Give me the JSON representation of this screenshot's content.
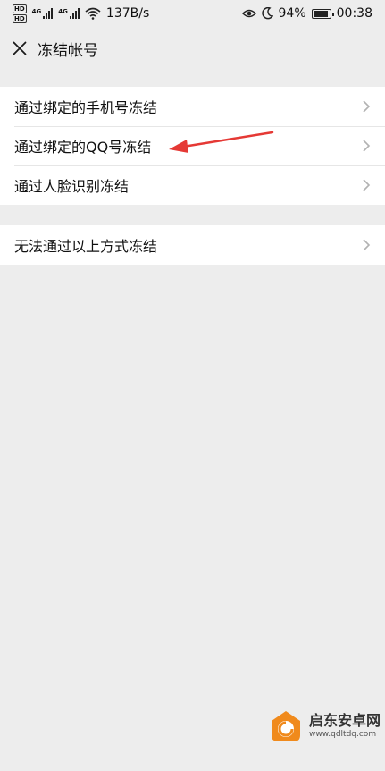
{
  "status_bar": {
    "hd_label": "HD",
    "net_1": "4G",
    "net_2": "4G",
    "speed": "137B/s",
    "battery_percent": "94%",
    "battery_level": 0.94,
    "time": "00:38"
  },
  "title_bar": {
    "title": "冻结帐号"
  },
  "options_group_1": [
    {
      "label": "通过绑定的手机号冻结"
    },
    {
      "label": "通过绑定的QQ号冻结"
    },
    {
      "label": "通过人脸识别冻结"
    }
  ],
  "options_group_2": [
    {
      "label": "无法通过以上方式冻结"
    }
  ],
  "annotation": {
    "color": "#e53935"
  },
  "watermark": {
    "name": "启东安卓网",
    "url": "www.qdltdq.com",
    "logo_color": "#f08a1c"
  },
  "colors": {
    "background": "#ededed",
    "card": "#ffffff",
    "chevron": "#b2b2b2"
  }
}
